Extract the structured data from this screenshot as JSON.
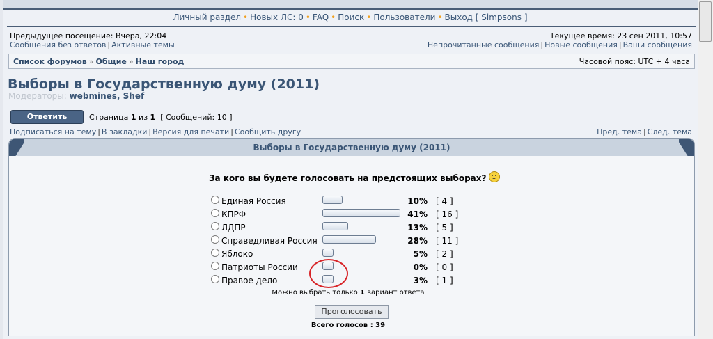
{
  "nav": {
    "items": [
      "Личный раздел",
      "Новых ЛС: 0",
      "FAQ",
      "Поиск",
      "Пользователи",
      "Выход [ Simpsons ]"
    ]
  },
  "info": {
    "prev_visit": "Предыдущее посещение: Вчера, 22:04",
    "unanswered": "Сообщения без ответов",
    "active": "Активные темы",
    "current_time": "Текущее время: 23 сен 2011, 10:57",
    "unread": "Непрочитанные сообщения",
    "new_posts": "Новые сообщения",
    "your_posts": "Ваши сообщения"
  },
  "breadcrumb": {
    "items": [
      "Список форумов",
      "Общие",
      "Наш город"
    ],
    "sep": "»",
    "timezone": "Часовой пояс: UTC + 4 часа"
  },
  "topic": {
    "title": "Выборы в Государственную думу (2011)",
    "moderators_label": "Модераторы:",
    "moderators": "webmines, Shef"
  },
  "actions": {
    "reply": "Ответить",
    "page_prefix": "Страница",
    "page_current": "1",
    "page_of": "из",
    "page_total": "1",
    "posts": "[ Сообщений: 10 ]",
    "subscribe": "Подписаться на тему",
    "bookmark": "В закладки",
    "print": "Версия для печати",
    "tell": "Сообщить другу",
    "prev_topic": "Пред. тема",
    "next_topic": "След. тема"
  },
  "poll": {
    "header": "Выборы в Государственную думу (2011)",
    "question": "За кого вы будете голосовать на предстоящих выборах?",
    "options": [
      {
        "label": "Единая Россия",
        "percent": "10%",
        "votes": "[ 4 ]",
        "value": 10
      },
      {
        "label": "КПРФ",
        "percent": "41%",
        "votes": "[ 16 ]",
        "value": 41
      },
      {
        "label": "ЛДПР",
        "percent": "13%",
        "votes": "[ 5 ]",
        "value": 13
      },
      {
        "label": "Справедливая Россия",
        "percent": "28%",
        "votes": "[ 11 ]",
        "value": 28
      },
      {
        "label": "Яблоко",
        "percent": "5%",
        "votes": "[ 2 ]",
        "value": 5
      },
      {
        "label": "Патриоты России",
        "percent": "0%",
        "votes": "[ 0 ]",
        "value": 0
      },
      {
        "label": "Правое дело",
        "percent": "3%",
        "votes": "[ 1 ]",
        "value": 3
      }
    ],
    "limit_pre": "Можно выбрать только",
    "limit_num": "1",
    "limit_post": "вариант ответа",
    "vote_button": "Проголосовать",
    "total": "Всего голосов : 39"
  }
}
